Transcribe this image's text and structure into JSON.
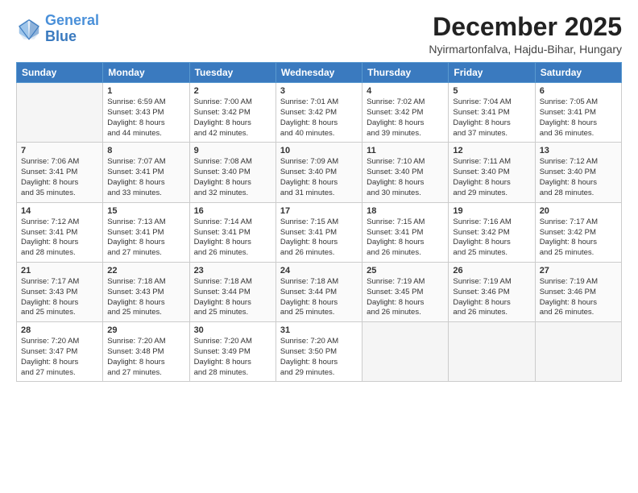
{
  "header": {
    "logo_general": "General",
    "logo_blue": "Blue",
    "month": "December 2025",
    "location": "Nyirmartonfalva, Hajdu-Bihar, Hungary"
  },
  "days_of_week": [
    "Sunday",
    "Monday",
    "Tuesday",
    "Wednesday",
    "Thursday",
    "Friday",
    "Saturday"
  ],
  "weeks": [
    [
      {
        "day": "",
        "empty": true
      },
      {
        "day": "1",
        "sunrise": "Sunrise: 6:59 AM",
        "sunset": "Sunset: 3:43 PM",
        "daylight": "Daylight: 8 hours",
        "minutes": "and 44 minutes."
      },
      {
        "day": "2",
        "sunrise": "Sunrise: 7:00 AM",
        "sunset": "Sunset: 3:42 PM",
        "daylight": "Daylight: 8 hours",
        "minutes": "and 42 minutes."
      },
      {
        "day": "3",
        "sunrise": "Sunrise: 7:01 AM",
        "sunset": "Sunset: 3:42 PM",
        "daylight": "Daylight: 8 hours",
        "minutes": "and 40 minutes."
      },
      {
        "day": "4",
        "sunrise": "Sunrise: 7:02 AM",
        "sunset": "Sunset: 3:42 PM",
        "daylight": "Daylight: 8 hours",
        "minutes": "and 39 minutes."
      },
      {
        "day": "5",
        "sunrise": "Sunrise: 7:04 AM",
        "sunset": "Sunset: 3:41 PM",
        "daylight": "Daylight: 8 hours",
        "minutes": "and 37 minutes."
      },
      {
        "day": "6",
        "sunrise": "Sunrise: 7:05 AM",
        "sunset": "Sunset: 3:41 PM",
        "daylight": "Daylight: 8 hours",
        "minutes": "and 36 minutes."
      }
    ],
    [
      {
        "day": "7",
        "sunrise": "Sunrise: 7:06 AM",
        "sunset": "Sunset: 3:41 PM",
        "daylight": "Daylight: 8 hours",
        "minutes": "and 35 minutes."
      },
      {
        "day": "8",
        "sunrise": "Sunrise: 7:07 AM",
        "sunset": "Sunset: 3:41 PM",
        "daylight": "Daylight: 8 hours",
        "minutes": "and 33 minutes."
      },
      {
        "day": "9",
        "sunrise": "Sunrise: 7:08 AM",
        "sunset": "Sunset: 3:40 PM",
        "daylight": "Daylight: 8 hours",
        "minutes": "and 32 minutes."
      },
      {
        "day": "10",
        "sunrise": "Sunrise: 7:09 AM",
        "sunset": "Sunset: 3:40 PM",
        "daylight": "Daylight: 8 hours",
        "minutes": "and 31 minutes."
      },
      {
        "day": "11",
        "sunrise": "Sunrise: 7:10 AM",
        "sunset": "Sunset: 3:40 PM",
        "daylight": "Daylight: 8 hours",
        "minutes": "and 30 minutes."
      },
      {
        "day": "12",
        "sunrise": "Sunrise: 7:11 AM",
        "sunset": "Sunset: 3:40 PM",
        "daylight": "Daylight: 8 hours",
        "minutes": "and 29 minutes."
      },
      {
        "day": "13",
        "sunrise": "Sunrise: 7:12 AM",
        "sunset": "Sunset: 3:40 PM",
        "daylight": "Daylight: 8 hours",
        "minutes": "and 28 minutes."
      }
    ],
    [
      {
        "day": "14",
        "sunrise": "Sunrise: 7:12 AM",
        "sunset": "Sunset: 3:41 PM",
        "daylight": "Daylight: 8 hours",
        "minutes": "and 28 minutes."
      },
      {
        "day": "15",
        "sunrise": "Sunrise: 7:13 AM",
        "sunset": "Sunset: 3:41 PM",
        "daylight": "Daylight: 8 hours",
        "minutes": "and 27 minutes."
      },
      {
        "day": "16",
        "sunrise": "Sunrise: 7:14 AM",
        "sunset": "Sunset: 3:41 PM",
        "daylight": "Daylight: 8 hours",
        "minutes": "and 26 minutes."
      },
      {
        "day": "17",
        "sunrise": "Sunrise: 7:15 AM",
        "sunset": "Sunset: 3:41 PM",
        "daylight": "Daylight: 8 hours",
        "minutes": "and 26 minutes."
      },
      {
        "day": "18",
        "sunrise": "Sunrise: 7:15 AM",
        "sunset": "Sunset: 3:41 PM",
        "daylight": "Daylight: 8 hours",
        "minutes": "and 26 minutes."
      },
      {
        "day": "19",
        "sunrise": "Sunrise: 7:16 AM",
        "sunset": "Sunset: 3:42 PM",
        "daylight": "Daylight: 8 hours",
        "minutes": "and 25 minutes."
      },
      {
        "day": "20",
        "sunrise": "Sunrise: 7:17 AM",
        "sunset": "Sunset: 3:42 PM",
        "daylight": "Daylight: 8 hours",
        "minutes": "and 25 minutes."
      }
    ],
    [
      {
        "day": "21",
        "sunrise": "Sunrise: 7:17 AM",
        "sunset": "Sunset: 3:43 PM",
        "daylight": "Daylight: 8 hours",
        "minutes": "and 25 minutes."
      },
      {
        "day": "22",
        "sunrise": "Sunrise: 7:18 AM",
        "sunset": "Sunset: 3:43 PM",
        "daylight": "Daylight: 8 hours",
        "minutes": "and 25 minutes."
      },
      {
        "day": "23",
        "sunrise": "Sunrise: 7:18 AM",
        "sunset": "Sunset: 3:44 PM",
        "daylight": "Daylight: 8 hours",
        "minutes": "and 25 minutes."
      },
      {
        "day": "24",
        "sunrise": "Sunrise: 7:18 AM",
        "sunset": "Sunset: 3:44 PM",
        "daylight": "Daylight: 8 hours",
        "minutes": "and 25 minutes."
      },
      {
        "day": "25",
        "sunrise": "Sunrise: 7:19 AM",
        "sunset": "Sunset: 3:45 PM",
        "daylight": "Daylight: 8 hours",
        "minutes": "and 26 minutes."
      },
      {
        "day": "26",
        "sunrise": "Sunrise: 7:19 AM",
        "sunset": "Sunset: 3:46 PM",
        "daylight": "Daylight: 8 hours",
        "minutes": "and 26 minutes."
      },
      {
        "day": "27",
        "sunrise": "Sunrise: 7:19 AM",
        "sunset": "Sunset: 3:46 PM",
        "daylight": "Daylight: 8 hours",
        "minutes": "and 26 minutes."
      }
    ],
    [
      {
        "day": "28",
        "sunrise": "Sunrise: 7:20 AM",
        "sunset": "Sunset: 3:47 PM",
        "daylight": "Daylight: 8 hours",
        "minutes": "and 27 minutes."
      },
      {
        "day": "29",
        "sunrise": "Sunrise: 7:20 AM",
        "sunset": "Sunset: 3:48 PM",
        "daylight": "Daylight: 8 hours",
        "minutes": "and 27 minutes."
      },
      {
        "day": "30",
        "sunrise": "Sunrise: 7:20 AM",
        "sunset": "Sunset: 3:49 PM",
        "daylight": "Daylight: 8 hours",
        "minutes": "and 28 minutes."
      },
      {
        "day": "31",
        "sunrise": "Sunrise: 7:20 AM",
        "sunset": "Sunset: 3:50 PM",
        "daylight": "Daylight: 8 hours",
        "minutes": "and 29 minutes."
      },
      {
        "day": "",
        "empty": true
      },
      {
        "day": "",
        "empty": true
      },
      {
        "day": "",
        "empty": true
      }
    ]
  ]
}
